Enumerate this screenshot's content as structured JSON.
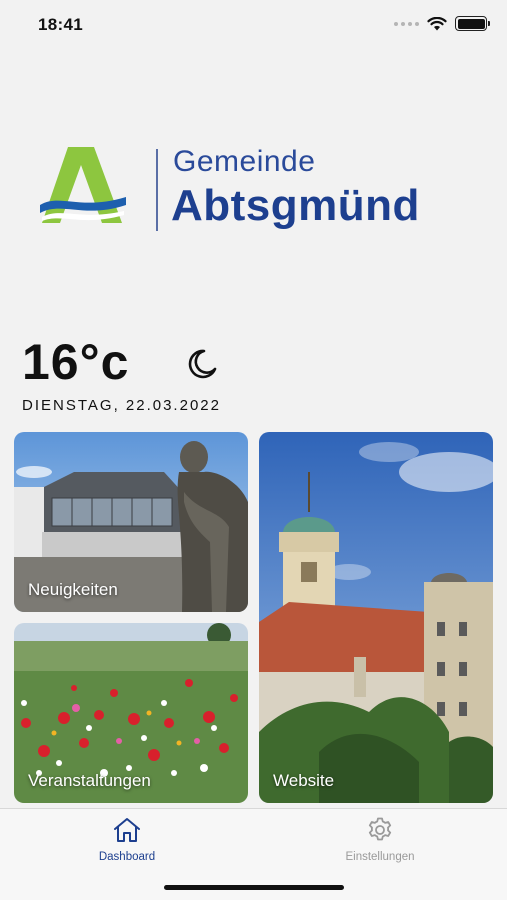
{
  "status_bar": {
    "time": "18:41"
  },
  "logo": {
    "line1": "Gemeinde",
    "line2": "Abtsgmünd"
  },
  "weather": {
    "temperature": "16°c",
    "date": "DIENSTAG, 22.03.2022",
    "condition_icon": "moon-icon"
  },
  "tiles": {
    "news": {
      "label": "Neuigkeiten"
    },
    "events": {
      "label": "Veranstaltungen"
    },
    "website": {
      "label": "Website"
    }
  },
  "tab_bar": {
    "dashboard_label": "Dashboard",
    "settings_label": "Einstellungen",
    "active_color": "#1d3f8f",
    "inactive_color": "#9a9a9a"
  },
  "colors": {
    "brand_blue": "#1d3f8f",
    "brand_green": "#8dc63f"
  }
}
